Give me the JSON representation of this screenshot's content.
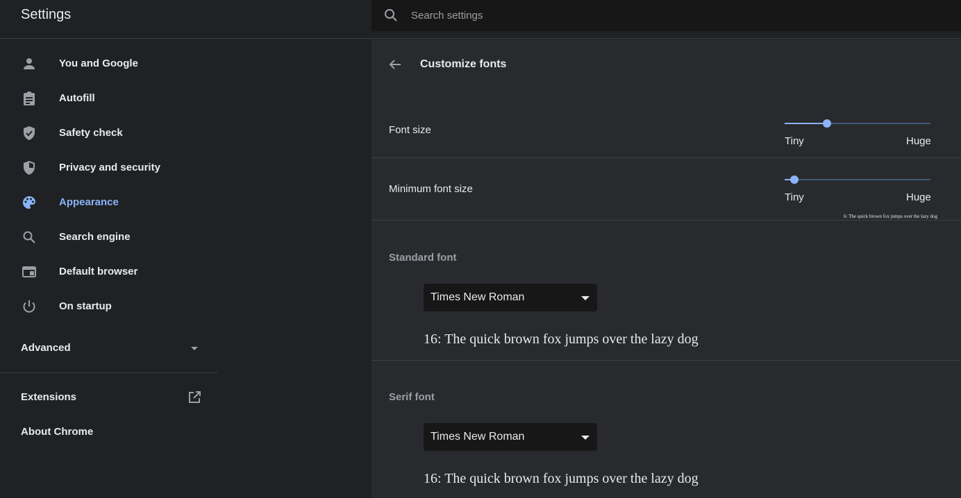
{
  "app": {
    "title": "Settings"
  },
  "search": {
    "placeholder": "Search settings"
  },
  "sidebar": {
    "items": [
      {
        "label": "You and Google",
        "icon": "person-icon"
      },
      {
        "label": "Autofill",
        "icon": "clipboard-icon"
      },
      {
        "label": "Safety check",
        "icon": "shield-check-icon"
      },
      {
        "label": "Privacy and security",
        "icon": "shield-half-icon"
      },
      {
        "label": "Appearance",
        "icon": "palette-icon",
        "active": true
      },
      {
        "label": "Search engine",
        "icon": "search-icon"
      },
      {
        "label": "Default browser",
        "icon": "browser-icon"
      },
      {
        "label": "On startup",
        "icon": "power-icon"
      }
    ],
    "advanced": "Advanced",
    "extensions": "Extensions",
    "about": "About Chrome"
  },
  "main": {
    "title": "Customize fonts",
    "font_size": {
      "label": "Font size",
      "min": "Tiny",
      "max": "Huge",
      "level": 0.29
    },
    "min_font_size": {
      "label": "Minimum font size",
      "min": "Tiny",
      "max": "Huge",
      "level": 0.065,
      "sample": "6: The quick brown fox jumps over the lazy dog"
    },
    "standard_font": {
      "label": "Standard font",
      "value": "Times New Roman",
      "sample": "16: The quick brown fox jumps over the lazy dog"
    },
    "serif_font": {
      "label": "Serif font",
      "value": "Times New Roman",
      "sample": "16: The quick brown fox jumps over the lazy dog"
    }
  },
  "colors": {
    "accent": "#8ab4f8",
    "background": "#202124",
    "panel": "#292a2d",
    "muted": "#9aa0a6"
  }
}
